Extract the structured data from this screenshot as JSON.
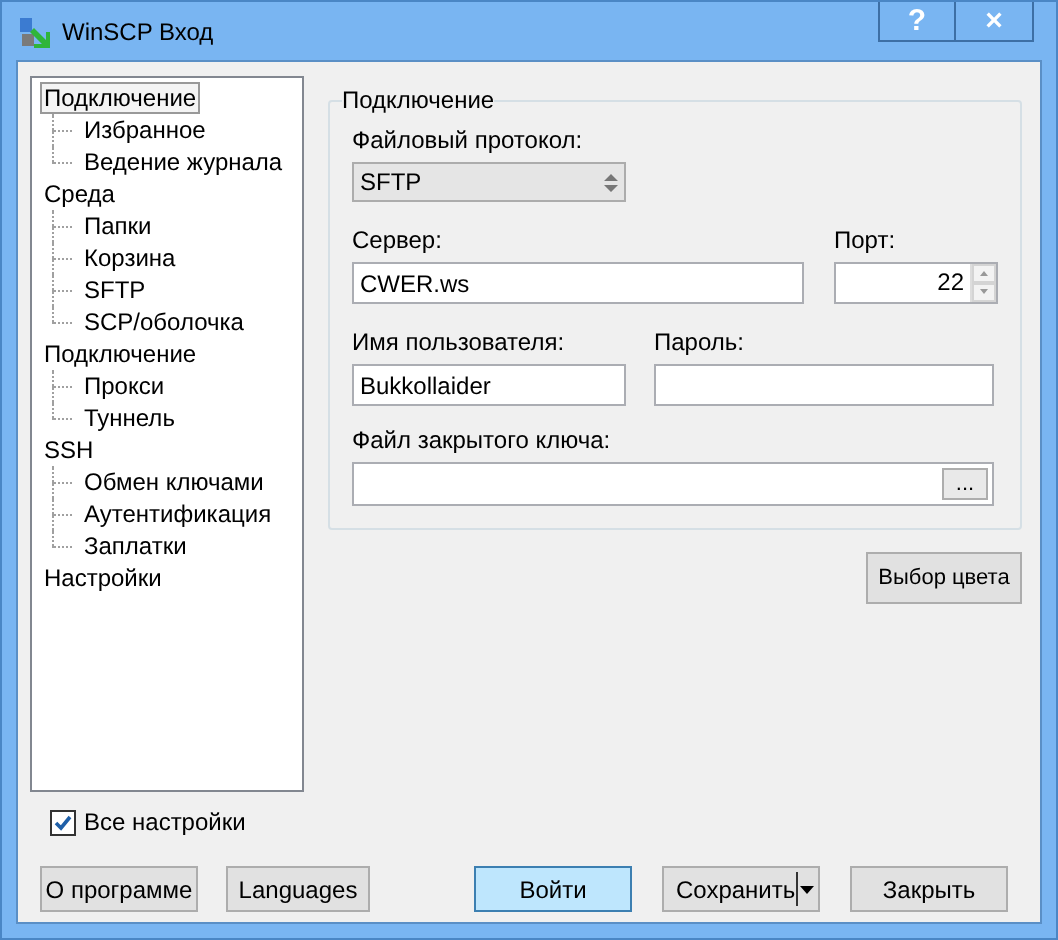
{
  "window": {
    "title": "WinSCP Вход",
    "buttons": [
      {
        "kind": "help",
        "label": "?"
      },
      {
        "kind": "close",
        "label": "×"
      }
    ]
  },
  "tree": [
    {
      "label": "Подключение",
      "selected": true,
      "children": [
        {
          "label": "Избранное",
          "selected": false
        },
        {
          "label": "Ведение журнала",
          "selected": false
        }
      ]
    },
    {
      "label": "Среда",
      "selected": false,
      "children": [
        {
          "label": "Папки",
          "selected": false
        },
        {
          "label": "Корзина",
          "selected": false
        },
        {
          "label": "SFTP",
          "selected": false
        },
        {
          "label": "SCP/оболочка",
          "selected": false
        }
      ]
    },
    {
      "label": "Подключение",
      "selected": false,
      "children": [
        {
          "label": "Прокси",
          "selected": false
        },
        {
          "label": "Туннель",
          "selected": false
        }
      ]
    },
    {
      "label": "SSH",
      "selected": false,
      "children": [
        {
          "label": "Обмен ключами",
          "selected": false
        },
        {
          "label": "Аутентификация",
          "selected": false
        },
        {
          "label": "Заплатки",
          "selected": false
        }
      ]
    },
    {
      "label": "Настройки",
      "selected": false
    }
  ],
  "session": {
    "title": "Подключение",
    "protocol": {
      "label": "Файловый протокол:",
      "value": "SFTP"
    },
    "host": {
      "label": "Сервер:",
      "value": "CWER.ws"
    },
    "port": {
      "label": "Порт:",
      "value": "22"
    },
    "user": {
      "label": "Имя пользователя:",
      "value": "Bukkollaider"
    },
    "password": {
      "label": "Пароль:"
    },
    "key_file": {
      "label": "Файл закрытого ключа:",
      "browse": "..."
    }
  },
  "color_button": "Выбор цвета",
  "all_settings": {
    "label": "Все настройки",
    "checked": true
  },
  "left_buttons": [
    "О программе",
    "Languages"
  ],
  "buttons": [
    {
      "label": "Войти",
      "kind": "default"
    },
    {
      "label": "Сохранить",
      "kind": "split"
    },
    {
      "label": "Закрыть",
      "kind": "normal"
    }
  ]
}
